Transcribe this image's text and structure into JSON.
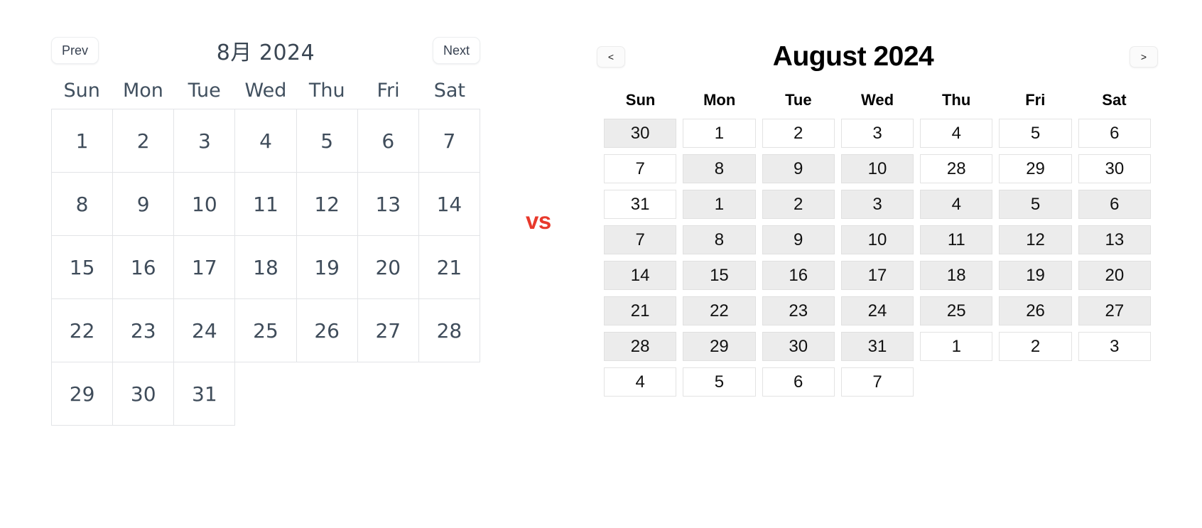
{
  "comparison": {
    "separator_label": "vs",
    "separator_color": "#e8392c"
  },
  "left_calendar": {
    "name": "japanese-style-calendar",
    "prev_label": "Prev",
    "next_label": "Next",
    "title": "8月 2024",
    "month": "8月",
    "year": "2024",
    "weekday_headers": [
      "Sun",
      "Mon",
      "Tue",
      "Wed",
      "Thu",
      "Fri",
      "Sat"
    ],
    "text_color": "#3f4c5a",
    "border_color": "#e2e4e7",
    "weeks": [
      [
        {
          "day": "1",
          "blank": false
        },
        {
          "day": "2",
          "blank": false
        },
        {
          "day": "3",
          "blank": false
        },
        {
          "day": "4",
          "blank": false
        },
        {
          "day": "5",
          "blank": false
        },
        {
          "day": "6",
          "blank": false
        },
        {
          "day": "7",
          "blank": false
        }
      ],
      [
        {
          "day": "8",
          "blank": false
        },
        {
          "day": "9",
          "blank": false
        },
        {
          "day": "10",
          "blank": false
        },
        {
          "day": "11",
          "blank": false
        },
        {
          "day": "12",
          "blank": false
        },
        {
          "day": "13",
          "blank": false
        },
        {
          "day": "14",
          "blank": false
        }
      ],
      [
        {
          "day": "15",
          "blank": false
        },
        {
          "day": "16",
          "blank": false
        },
        {
          "day": "17",
          "blank": false
        },
        {
          "day": "18",
          "blank": false
        },
        {
          "day": "19",
          "blank": false
        },
        {
          "day": "20",
          "blank": false
        },
        {
          "day": "21",
          "blank": false
        }
      ],
      [
        {
          "day": "22",
          "blank": false
        },
        {
          "day": "23",
          "blank": false
        },
        {
          "day": "24",
          "blank": false
        },
        {
          "day": "25",
          "blank": false
        },
        {
          "day": "26",
          "blank": false
        },
        {
          "day": "27",
          "blank": false
        },
        {
          "day": "28",
          "blank": false
        }
      ],
      [
        {
          "day": "29",
          "blank": false
        },
        {
          "day": "30",
          "blank": false
        },
        {
          "day": "31",
          "blank": false
        },
        {
          "day": "",
          "blank": true
        },
        {
          "day": "",
          "blank": true
        },
        {
          "day": "",
          "blank": true
        },
        {
          "day": "",
          "blank": true
        }
      ]
    ]
  },
  "right_calendar": {
    "name": "english-style-calendar",
    "prev_label": "<",
    "next_label": ">",
    "title": "August 2024",
    "month": "August",
    "year": "2024",
    "weekday_headers": [
      "Sun",
      "Mon",
      "Tue",
      "Wed",
      "Thu",
      "Fri",
      "Sat"
    ],
    "text_color": "#111111",
    "shaded_color": "#ececec",
    "border_color": "#e3e3e3",
    "weeks": [
      [
        {
          "day": "30",
          "shaded": true,
          "blank": false
        },
        {
          "day": "1",
          "shaded": false,
          "blank": false
        },
        {
          "day": "2",
          "shaded": false,
          "blank": false
        },
        {
          "day": "3",
          "shaded": false,
          "blank": false
        },
        {
          "day": "4",
          "shaded": false,
          "blank": false
        },
        {
          "day": "5",
          "shaded": false,
          "blank": false
        },
        {
          "day": "6",
          "shaded": false,
          "blank": false
        }
      ],
      [
        {
          "day": "7",
          "shaded": false,
          "blank": false
        },
        {
          "day": "8",
          "shaded": true,
          "blank": false
        },
        {
          "day": "9",
          "shaded": true,
          "blank": false
        },
        {
          "day": "10",
          "shaded": true,
          "blank": false
        },
        {
          "day": "28",
          "shaded": false,
          "blank": false
        },
        {
          "day": "29",
          "shaded": false,
          "blank": false
        },
        {
          "day": "30",
          "shaded": false,
          "blank": false
        }
      ],
      [
        {
          "day": "31",
          "shaded": false,
          "blank": false
        },
        {
          "day": "1",
          "shaded": true,
          "blank": false
        },
        {
          "day": "2",
          "shaded": true,
          "blank": false
        },
        {
          "day": "3",
          "shaded": true,
          "blank": false
        },
        {
          "day": "4",
          "shaded": true,
          "blank": false
        },
        {
          "day": "5",
          "shaded": true,
          "blank": false
        },
        {
          "day": "6",
          "shaded": true,
          "blank": false
        }
      ],
      [
        {
          "day": "7",
          "shaded": true,
          "blank": false
        },
        {
          "day": "8",
          "shaded": true,
          "blank": false
        },
        {
          "day": "9",
          "shaded": true,
          "blank": false
        },
        {
          "day": "10",
          "shaded": true,
          "blank": false
        },
        {
          "day": "11",
          "shaded": true,
          "blank": false
        },
        {
          "day": "12",
          "shaded": true,
          "blank": false
        },
        {
          "day": "13",
          "shaded": true,
          "blank": false
        }
      ],
      [
        {
          "day": "14",
          "shaded": true,
          "blank": false
        },
        {
          "day": "15",
          "shaded": true,
          "blank": false
        },
        {
          "day": "16",
          "shaded": true,
          "blank": false
        },
        {
          "day": "17",
          "shaded": true,
          "blank": false
        },
        {
          "day": "18",
          "shaded": true,
          "blank": false
        },
        {
          "day": "19",
          "shaded": true,
          "blank": false
        },
        {
          "day": "20",
          "shaded": true,
          "blank": false
        }
      ],
      [
        {
          "day": "21",
          "shaded": true,
          "blank": false
        },
        {
          "day": "22",
          "shaded": true,
          "blank": false
        },
        {
          "day": "23",
          "shaded": true,
          "blank": false
        },
        {
          "day": "24",
          "shaded": true,
          "blank": false
        },
        {
          "day": "25",
          "shaded": true,
          "blank": false
        },
        {
          "day": "26",
          "shaded": true,
          "blank": false
        },
        {
          "day": "27",
          "shaded": true,
          "blank": false
        }
      ],
      [
        {
          "day": "28",
          "shaded": true,
          "blank": false
        },
        {
          "day": "29",
          "shaded": true,
          "blank": false
        },
        {
          "day": "30",
          "shaded": true,
          "blank": false
        },
        {
          "day": "31",
          "shaded": true,
          "blank": false
        },
        {
          "day": "1",
          "shaded": false,
          "blank": false
        },
        {
          "day": "2",
          "shaded": false,
          "blank": false
        },
        {
          "day": "3",
          "shaded": false,
          "blank": false
        }
      ],
      [
        {
          "day": "4",
          "shaded": false,
          "blank": false
        },
        {
          "day": "5",
          "shaded": false,
          "blank": false
        },
        {
          "day": "6",
          "shaded": false,
          "blank": false
        },
        {
          "day": "7",
          "shaded": false,
          "blank": false
        },
        {
          "day": "",
          "shaded": false,
          "blank": true
        },
        {
          "day": "",
          "shaded": false,
          "blank": true
        },
        {
          "day": "",
          "shaded": false,
          "blank": true
        }
      ]
    ]
  }
}
